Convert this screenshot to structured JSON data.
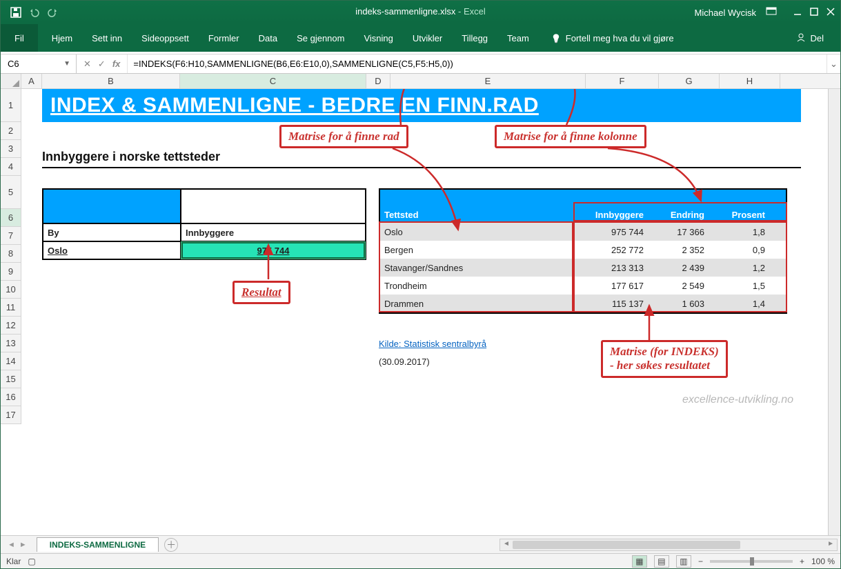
{
  "titlebar": {
    "filename": "indeks-sammenligne.xlsx",
    "appname": "Excel",
    "separator": "  -  ",
    "username": "Michael Wycisk"
  },
  "ribbon": {
    "file": "Fil",
    "tabs": [
      "Hjem",
      "Sett inn",
      "Sideoppsett",
      "Formler",
      "Data",
      "Se gjennom",
      "Visning",
      "Utvikler",
      "Tillegg",
      "Team"
    ],
    "tellme": "Fortell meg hva du vil gjøre",
    "share": "Del"
  },
  "namebox": {
    "value": "C6"
  },
  "fx_label": "fx",
  "formula": "=INDEKS(F6:H10,SAMMENLIGNE(B6,E6:E10,0),SAMMENLIGNE(C5,F5:H5,0))",
  "columns": [
    "A",
    "B",
    "C",
    "D",
    "E",
    "F",
    "G",
    "H"
  ],
  "rows": [
    "1",
    "2",
    "3",
    "4",
    "5",
    "6",
    "7",
    "8",
    "9",
    "10",
    "11",
    "12",
    "13",
    "14",
    "15",
    "16",
    "17"
  ],
  "banner": "INDEX & SAMMENLIGNE - BEDRE EN FINN.RAD",
  "subtitle": "Innbyggere i norske tettsteder",
  "result_table": {
    "h_by": "By",
    "h_val": "Innbyggere",
    "city": "Oslo",
    "value": "975 744"
  },
  "data_table": {
    "headers": {
      "tettsted": "Tettsted",
      "innbyggere": "Innbyggere",
      "endring": "Endring",
      "prosent": "Prosent"
    },
    "rows": [
      {
        "e": "Oslo",
        "f": "975 744",
        "g": "17 366",
        "h": "1,8"
      },
      {
        "e": "Bergen",
        "f": "252 772",
        "g": "2 352",
        "h": "0,9"
      },
      {
        "e": "Stavanger/Sandnes",
        "f": "213 313",
        "g": "2 439",
        "h": "1,2"
      },
      {
        "e": "Trondheim",
        "f": "177 617",
        "g": "2 549",
        "h": "1,5"
      },
      {
        "e": "Drammen",
        "f": "115 137",
        "g": "1 603",
        "h": "1,4"
      }
    ]
  },
  "source_link": "Kilde: Statistisk sentralbyrå",
  "source_date": "(30.09.2017)",
  "watermark": "excellence-utvikling.no",
  "annot": {
    "rad": "Matrise for å finne rad",
    "kolonne": "Matrise for å finne kolonne",
    "resultat": "Resultat",
    "indeks_l1": "Matrise (for INDEKS)",
    "indeks_l2": "- her søkes resultatet"
  },
  "sheet_tab": "INDEKS-SAMMENLIGNE",
  "status_ready": "Klar",
  "zoom": "100 %"
}
